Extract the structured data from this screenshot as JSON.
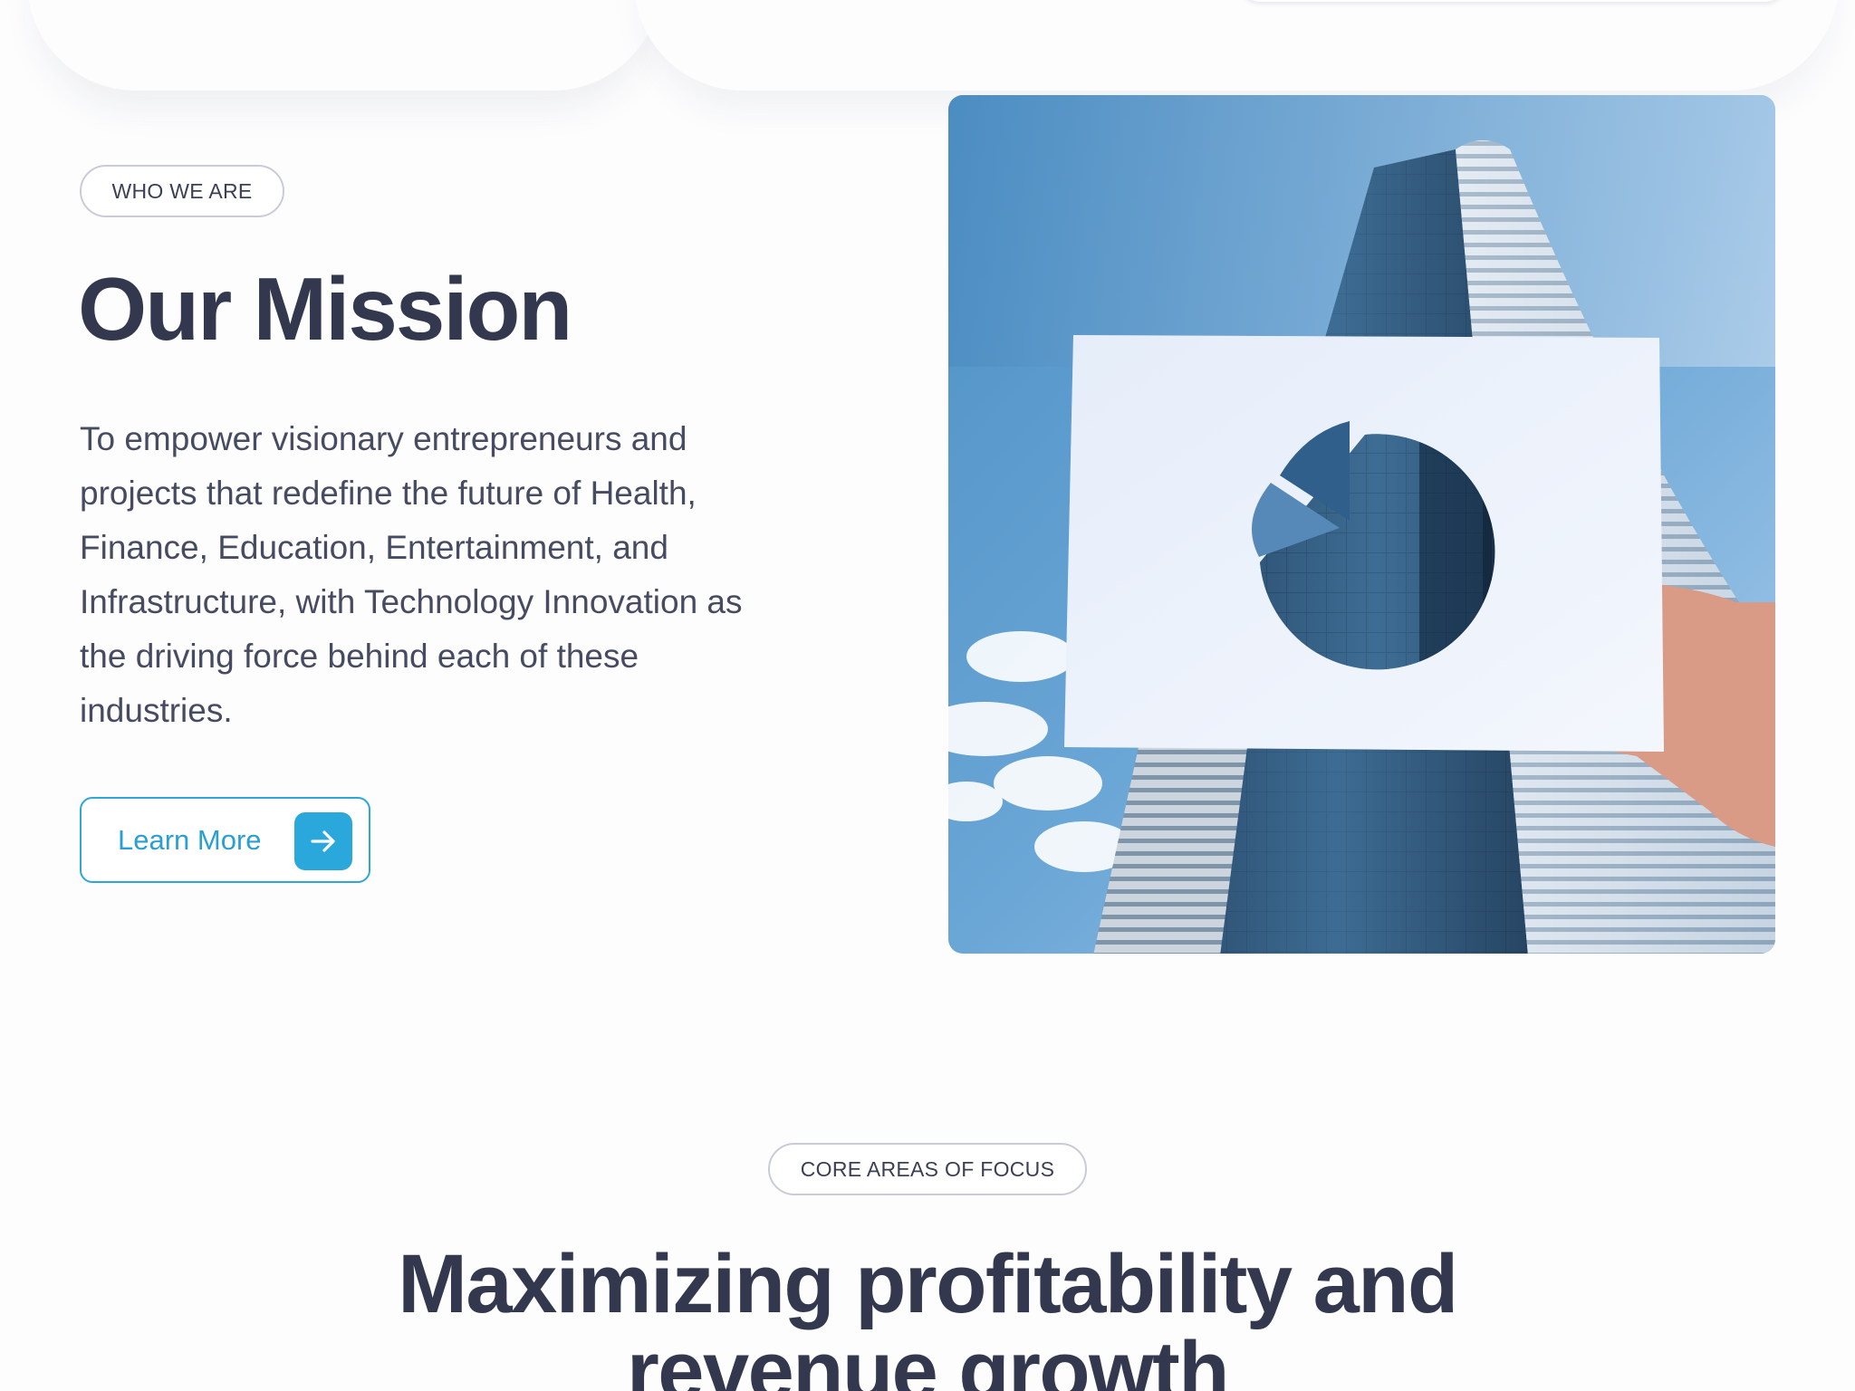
{
  "about": {
    "badge": "WHO WE ARE",
    "title": "Our Mission",
    "body": "To empower visionary entrepreneurs and projects that redefine the future of Health, Finance, Education, Entertainment, and Infrastructure, with Technology Innovation as the driving force behind each of these industries.",
    "cta_label": "Learn More",
    "cta_icon": "arrow-right-icon",
    "accent_color": "#2aa8dc",
    "text_color": "#33384f"
  },
  "focus": {
    "badge": "CORE AREAS OF FOCUS",
    "title_line1": "Maximizing profitability and",
    "title_line2": "revenue growth"
  }
}
